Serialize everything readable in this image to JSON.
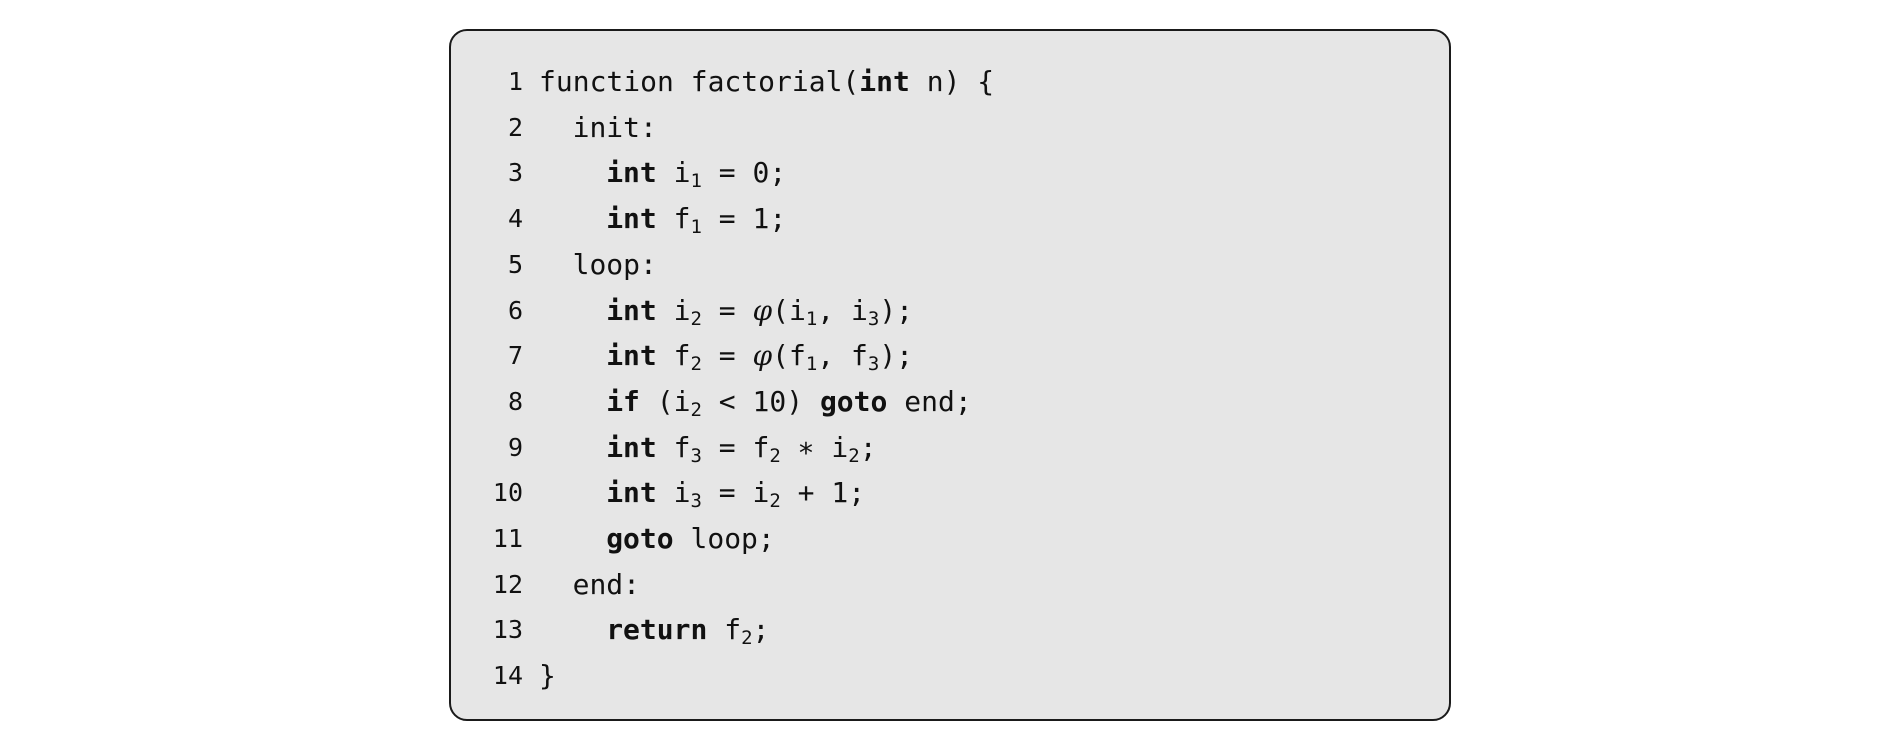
{
  "code_block": {
    "lines": [
      {
        "number": "1",
        "indent": 0,
        "tokens": [
          {
            "t": "function factorial("
          },
          {
            "t": "int",
            "kw": true
          },
          {
            "t": " n) {"
          }
        ]
      },
      {
        "number": "2",
        "indent": 2,
        "tokens": [
          {
            "t": "init:"
          }
        ]
      },
      {
        "number": "3",
        "indent": 4,
        "tokens": [
          {
            "t": "int",
            "kw": true
          },
          {
            "t": " i"
          },
          {
            "t": "1",
            "sub": true
          },
          {
            "t": " = 0;"
          }
        ]
      },
      {
        "number": "4",
        "indent": 4,
        "tokens": [
          {
            "t": "int",
            "kw": true
          },
          {
            "t": " f"
          },
          {
            "t": "1",
            "sub": true
          },
          {
            "t": " = 1;"
          }
        ]
      },
      {
        "number": "5",
        "indent": 2,
        "tokens": [
          {
            "t": "loop:"
          }
        ]
      },
      {
        "number": "6",
        "indent": 4,
        "tokens": [
          {
            "t": "int",
            "kw": true
          },
          {
            "t": " i"
          },
          {
            "t": "2",
            "sub": true
          },
          {
            "t": " = "
          },
          {
            "t": "φ",
            "phi": true
          },
          {
            "t": "(i"
          },
          {
            "t": "1",
            "sub": true
          },
          {
            "t": ", i"
          },
          {
            "t": "3",
            "sub": true
          },
          {
            "t": ");"
          }
        ]
      },
      {
        "number": "7",
        "indent": 4,
        "tokens": [
          {
            "t": "int",
            "kw": true
          },
          {
            "t": " f"
          },
          {
            "t": "2",
            "sub": true
          },
          {
            "t": " = "
          },
          {
            "t": "φ",
            "phi": true
          },
          {
            "t": "(f"
          },
          {
            "t": "1",
            "sub": true
          },
          {
            "t": ", f"
          },
          {
            "t": "3",
            "sub": true
          },
          {
            "t": ");"
          }
        ]
      },
      {
        "number": "8",
        "indent": 4,
        "tokens": [
          {
            "t": "if",
            "kw": true
          },
          {
            "t": " (i"
          },
          {
            "t": "2",
            "sub": true
          },
          {
            "t": " < 10) "
          },
          {
            "t": "goto",
            "kw": true
          },
          {
            "t": " end;"
          }
        ]
      },
      {
        "number": "9",
        "indent": 4,
        "tokens": [
          {
            "t": "int",
            "kw": true
          },
          {
            "t": " f"
          },
          {
            "t": "3",
            "sub": true
          },
          {
            "t": " = f"
          },
          {
            "t": "2",
            "sub": true
          },
          {
            "t": " ∗ i"
          },
          {
            "t": "2",
            "sub": true
          },
          {
            "t": ";"
          }
        ]
      },
      {
        "number": "10",
        "indent": 4,
        "tokens": [
          {
            "t": "int",
            "kw": true
          },
          {
            "t": " i"
          },
          {
            "t": "3",
            "sub": true
          },
          {
            "t": " = i"
          },
          {
            "t": "2",
            "sub": true
          },
          {
            "t": " + 1;"
          }
        ]
      },
      {
        "number": "11",
        "indent": 4,
        "tokens": [
          {
            "t": "goto",
            "kw": true
          },
          {
            "t": " loop;"
          }
        ]
      },
      {
        "number": "12",
        "indent": 2,
        "tokens": [
          {
            "t": "end:"
          }
        ]
      },
      {
        "number": "13",
        "indent": 4,
        "tokens": [
          {
            "t": "return",
            "kw": true
          },
          {
            "t": " f"
          },
          {
            "t": "2",
            "sub": true
          },
          {
            "t": ";"
          }
        ]
      },
      {
        "number": "14",
        "indent": 0,
        "tokens": [
          {
            "t": "}"
          }
        ]
      }
    ]
  }
}
